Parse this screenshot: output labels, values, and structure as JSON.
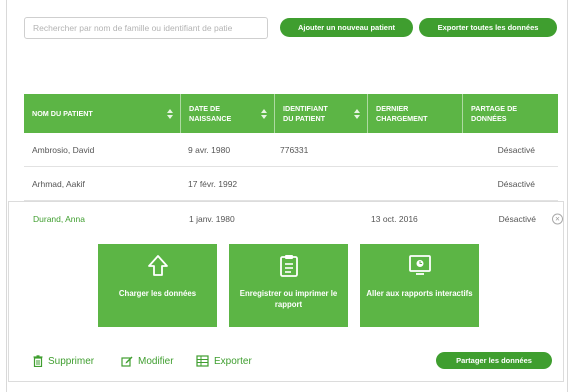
{
  "search": {
    "placeholder": "Rechercher par nom de famille ou identifiant de patie",
    "value": ""
  },
  "toolbar": {
    "add_label": "Ajouter un nouveau patient",
    "export_all_label": "Exporter toutes les données"
  },
  "table": {
    "headers": [
      {
        "line1": "NOM DU PATIENT",
        "line2": ""
      },
      {
        "line1": "DATE DE",
        "line2": "NAISSANCE"
      },
      {
        "line1": "IDENTIFIANT",
        "line2": "DU PATIENT"
      },
      {
        "line1": "DERNIER",
        "line2": "CHARGEMENT"
      },
      {
        "line1": "PARTAGE DE",
        "line2": "DONNÉES"
      }
    ],
    "rows": [
      {
        "name": "Ambrosio, David",
        "dob": "9 avr. 1980",
        "id": "776331",
        "last_upload": "",
        "sharing": "Désactivé"
      },
      {
        "name": "Arhmad, Aakif",
        "dob": "17 févr. 1992",
        "id": "",
        "last_upload": "",
        "sharing": "Désactivé"
      }
    ],
    "expanded_row": {
      "name": "Durand, Anna",
      "dob": "1 janv. 1980",
      "id": "",
      "last_upload": "13 oct. 2016",
      "sharing": "Désactivé"
    }
  },
  "tiles": [
    {
      "icon": "upload-arrow-icon",
      "label": "Charger les données"
    },
    {
      "icon": "clipboard-report-icon",
      "label": "Enregistrer ou imprimer le rapport"
    },
    {
      "icon": "interactive-report-icon",
      "label": "Aller aux rapports interactifs"
    }
  ],
  "actions": {
    "delete_label": "Supprimer",
    "edit_label": "Modifier",
    "export_label": "Exporter",
    "share_label": "Partager les données"
  },
  "colors": {
    "accent": "#5cb545",
    "accent_dark": "#3f9e2f",
    "text": "#555555"
  }
}
